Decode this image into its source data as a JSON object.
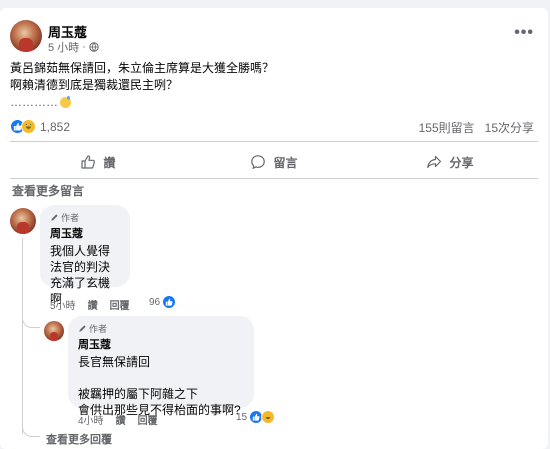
{
  "post": {
    "author": "周玉蔻",
    "time": "5 小時",
    "dot": "·",
    "lines": [
      "黃呂錦茹無保請回，朱立倫主席算是大獲全勝嗎？",
      "啊賴清德到底是獨裁還民主咧？",
      "…………"
    ],
    "reaction_count": "1,852",
    "comments_count": "155則留言",
    "shares_count": "15次分享"
  },
  "actions": {
    "like": "讚",
    "comment": "留言",
    "share": "分享"
  },
  "view_more_comments": "查看更多留言",
  "comment1": {
    "badge": "作者",
    "author": "周玉蔻",
    "text": "我個人覺得\n法官的判決\n充滿了玄機啊",
    "time": "5小時",
    "like": "讚",
    "reply": "回覆",
    "count": "96"
  },
  "comment2": {
    "badge": "作者",
    "author": "周玉蔻",
    "text": "長官無保請回\n\n被羈押的屬下阿雜之下\n會供出那些見不得枱面的事啊?",
    "time": "4小時",
    "like": "讚",
    "reply": "回覆",
    "count": "15"
  },
  "view_more_replies": "查看更多回覆",
  "colors": {
    "like_blue": "#1877f2",
    "haha_yellow": "#f7b928",
    "secondary_text": "#65676b"
  }
}
